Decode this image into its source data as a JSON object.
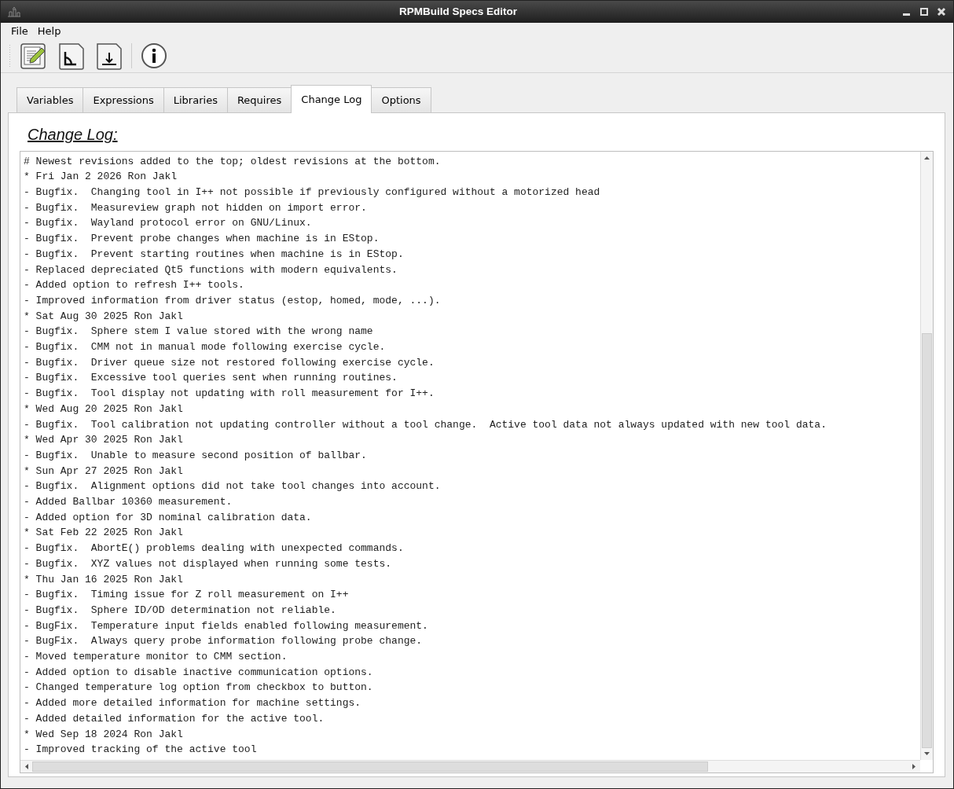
{
  "window": {
    "title": "RPMBuild Specs Editor"
  },
  "menu": [
    "File",
    "Help"
  ],
  "tabs": [
    {
      "label": "Variables",
      "selected": false
    },
    {
      "label": "Expressions",
      "selected": false
    },
    {
      "label": "Libraries",
      "selected": false
    },
    {
      "label": "Requires",
      "selected": false
    },
    {
      "label": "Change Log",
      "selected": true
    },
    {
      "label": "Options",
      "selected": false
    }
  ],
  "heading": "Change Log:",
  "log_lines": [
    "# Newest revisions added to the top; oldest revisions at the bottom.",
    "* Fri Jan 2 2026 Ron Jakl",
    "- Bugfix.  Changing tool in I++ not possible if previously configured without a motorized head",
    "- Bugfix.  Measureview graph not hidden on import error.",
    "- Bugfix.  Wayland protocol error on GNU/Linux.",
    "- Bugfix.  Prevent probe changes when machine is in EStop.",
    "- Bugfix.  Prevent starting routines when machine is in EStop.",
    "- Replaced depreciated Qt5 functions with modern equivalents.",
    "- Added option to refresh I++ tools.",
    "- Improved information from driver status (estop, homed, mode, ...).",
    "* Sat Aug 30 2025 Ron Jakl",
    "- Bugfix.  Sphere stem I value stored with the wrong name",
    "- Bugfix.  CMM not in manual mode following exercise cycle.",
    "- Bugfix.  Driver queue size not restored following exercise cycle.",
    "- Bugfix.  Excessive tool queries sent when running routines.",
    "- Bugfix.  Tool display not updating with roll measurement for I++.",
    "* Wed Aug 20 2025 Ron Jakl",
    "- Bugfix.  Tool calibration not updating controller without a tool change.  Active tool data not always updated with new tool data.",
    "* Wed Apr 30 2025 Ron Jakl",
    "- Bugfix.  Unable to measure second position of ballbar.",
    "* Sun Apr 27 2025 Ron Jakl",
    "- Bugfix.  Alignment options did not take tool changes into account.",
    "- Added Ballbar 10360 measurement.",
    "- Added option for 3D nominal calibration data.",
    "* Sat Feb 22 2025 Ron Jakl",
    "- Bugfix.  AbortE() problems dealing with unexpected commands.",
    "- Bugfix.  XYZ values not displayed when running some tests.",
    "* Thu Jan 16 2025 Ron Jakl",
    "- Bugfix.  Timing issue for Z roll measurement on I++",
    "- Bugfix.  Sphere ID/OD determination not reliable.",
    "- BugFix.  Temperature input fields enabled following measurement.",
    "- BugFix.  Always query probe information following probe change.",
    "- Moved temperature monitor to CMM section.",
    "- Added option to disable inactive communication options.",
    "- Changed temperature log option from checkbox to button.",
    "- Added more detailed information for machine settings.",
    "- Added detailed information for the active tool.",
    "* Wed Sep 18 2024 Ron Jakl",
    "- Improved tracking of the active tool"
  ]
}
